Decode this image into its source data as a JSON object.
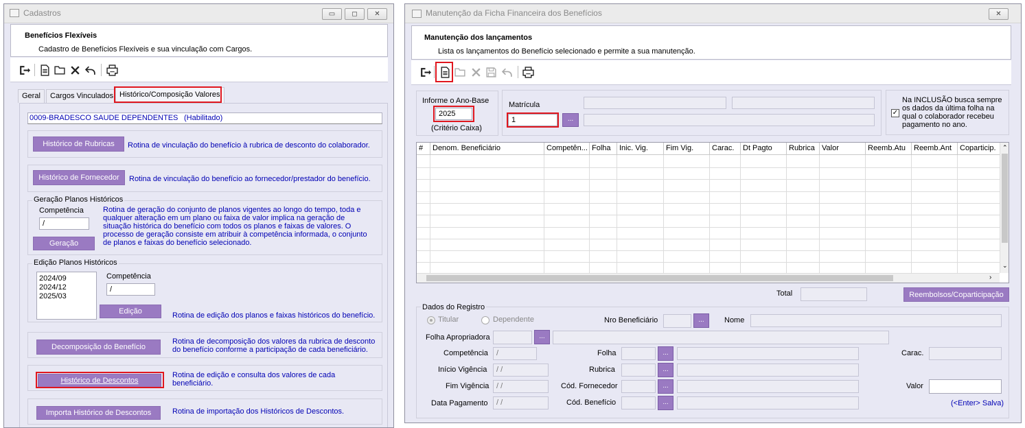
{
  "cadastros": {
    "window_title": "Cadastros",
    "header_title": "Benefícios Flexíveis",
    "header_subtitle": "Cadastro de Benefícios Flexíveis e sua vinculação com Cargos.",
    "tabs": [
      "Geral",
      "Cargos Vinculados",
      "Histórico/Composição Valores"
    ],
    "beneficio": "0009-BRADESCO SAUDE DEPENDENTES",
    "status": "(Habilitado)",
    "historico_rubricas": {
      "button": "Histórico de Rubricas",
      "desc": "Rotina de vinculação do benefício à rubrica de desconto do colaborador."
    },
    "historico_fornecedor": {
      "button": "Histórico de Fornecedor",
      "desc": "Rotina de vinculação do benefício ao fornecedor/prestador do benefício."
    },
    "geracao": {
      "group_label": "Geração Planos Históricos",
      "competencia_label": "Competência",
      "competencia_value": "  /",
      "button": "Geração",
      "desc": "Rotina de geração do conjunto de planos vigentes ao longo do tempo, toda e qualquer alteração em um plano ou faixa de valor implica na geração de situação histórica do benefício com todos os planos e faixas de valores. O processo de geração consiste em atribuir à competência informada, o conjunto de planos e faixas do benefício selecionado."
    },
    "edicao": {
      "group_label": "Edição Planos Históricos",
      "list": [
        "2024/09",
        "2024/12",
        "2025/03"
      ],
      "competencia_label": "Competência",
      "competencia_value": "  /",
      "button": "Edição",
      "desc": "Rotina de edição dos planos e faixas históricos do benefício."
    },
    "decomposicao": {
      "button": "Decomposição do Benefício",
      "desc": "Rotina de decomposição dos valores da rubrica de desconto do benefício conforme a participação de cada beneficiário."
    },
    "historico_descontos": {
      "button": "Histórico de Descontos",
      "desc": "Rotina de edição e consulta dos valores de cada beneficiário."
    },
    "importa": {
      "button": "Importa Histórico de Descontos",
      "desc": "Rotina de importação dos Históricos de Descontos."
    }
  },
  "manutencao": {
    "window_title": "Manutenção da Ficha Financeira dos Benefícios",
    "header_title": "Manutenção dos lançamentos",
    "header_subtitle": "Lista os lançamentos do Benefício selecionado e permite a sua manutenção.",
    "ano_base_label": "Informe o Ano-Base",
    "ano_base_value": "2025",
    "criterio": "(Critério Caixa)",
    "matricula_label": "Matrícula",
    "matricula_value": "1",
    "inclusao_text": "Na INCLUSÃO busca sempre os dados da última folha na qual o colaborador recebeu pagamento no ano.",
    "columns": [
      "#",
      "Denom. Beneficiário",
      "Competên...",
      "Folha",
      "Inic. Vig.",
      "Fim Vig.",
      "Carac.",
      "Dt Pagto",
      "Rubrica",
      "Valor",
      "Reemb.Atu",
      "Reemb.Ant",
      "Coparticip."
    ],
    "total_label": "Total",
    "reembolsos_button": "Reembolsos/Coparticipação",
    "dados_label": "Dados do Registro",
    "titular": "Titular",
    "dependente": "Dependente",
    "nro_beneficiario": "Nro Beneficiário",
    "nome": "Nome",
    "folha_apropriadora": "Folha Apropriadora",
    "competencia": "Competência",
    "competencia_value": "  /",
    "folha": "Folha",
    "carac": "Carac.",
    "inicio_vigencia": "Início Vigência",
    "inicio_value": " / /",
    "rubrica": "Rubrica",
    "fim_vigencia": "Fim Vigência",
    "fim_value": " / /",
    "cod_fornecedor": "Cód. Fornecedor",
    "valor": "Valor",
    "data_pagamento": "Data Pagamento",
    "data_value": " / /",
    "cod_beneficio": "Cód. Benefício",
    "enter_salva": "(<Enter> Salva)",
    "ellipsis": "..."
  }
}
